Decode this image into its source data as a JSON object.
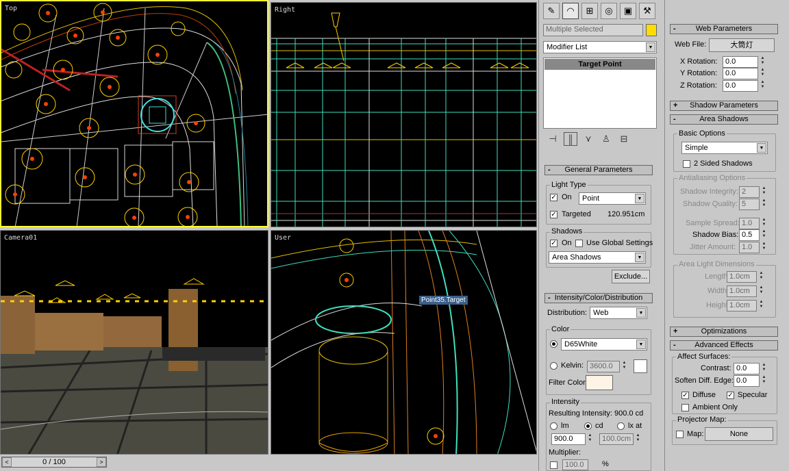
{
  "viewports": {
    "top": "Top",
    "right": "Right",
    "camera": "Camera01",
    "user": "User",
    "tag": "Point35.Target"
  },
  "timeline": {
    "frame": "0 / 100",
    "prev": "<",
    "next": ">"
  },
  "command": {
    "selection": "Multiple Selected",
    "selection_color": "#ffdd00",
    "modifier_list": "Modifier List",
    "stack_item": "Target Point",
    "icons": [
      "create-icon",
      "modify-icon",
      "hierarchy-icon",
      "motion-icon",
      "display-icon",
      "utilities-icon"
    ],
    "stack_tools": [
      "pin-icon",
      "show-end-result-icon",
      "make-unique-icon",
      "remove-modifier-icon",
      "configure-icon"
    ]
  },
  "general": {
    "title": "General Parameters",
    "light_type": "Light Type",
    "on": "On",
    "type_value": "Point",
    "targeted": "Targeted",
    "target_dist": "120.951cm",
    "shadows": "Shadows",
    "shadow_on": "On",
    "use_global": "Use Global Settings",
    "shadow_type": "Area Shadows",
    "exclude": "Exclude..."
  },
  "intensity": {
    "title": "Intensity/Color/Distribution",
    "distribution_label": "Distribution:",
    "distribution": "Web",
    "color": "Color",
    "preset": "D65White",
    "kelvin_label": "Kelvin:",
    "kelvin": "3600.0",
    "filter_label": "Filter Color:",
    "filter_color": "#fdf4e6",
    "kelvin_color": "#ffffff",
    "intensity_group": "Intensity",
    "resulting_label": "Resulting Intensity:",
    "resulting": "900.0 cd",
    "lm": "lm",
    "cd": "cd",
    "lxat": "lx at",
    "value": "900.0",
    "distance": "100.0cm",
    "multiplier_label": "Multiplier:",
    "multiplier": "100.0",
    "percent": "%"
  },
  "web": {
    "title": "Web Parameters",
    "file_label": "Web File:",
    "file": "大筒灯",
    "x_label": "X Rotation:",
    "y_label": "Y Rotation:",
    "z_label": "Z Rotation:",
    "x": "0.0",
    "y": "0.0",
    "z": "0.0"
  },
  "shadow_params": {
    "title": "Shadow Parameters"
  },
  "area_shadows": {
    "title": "Area Shadows",
    "basic": "Basic Options",
    "mode": "Simple",
    "two_sided": "2 Sided Shadows",
    "antialias": "Antialiasing Options",
    "integrity_label": "Shadow Integrity:",
    "integrity": "2",
    "quality_label": "Shadow Quality:",
    "quality": "5",
    "spread_label": "Sample Spread:",
    "spread": "1.0",
    "bias_label": "Shadow Bias:",
    "bias": "0.5",
    "jitter_label": "Jitter Amount:",
    "jitter": "1.0",
    "dims": "Area Light Dimensions",
    "length_label": "Length:",
    "length": "1.0cm",
    "width_label": "Width:",
    "width": "1.0cm",
    "height_label": "Height:",
    "height": "1.0cm"
  },
  "optimizations": {
    "title": "Optimizations"
  },
  "advanced": {
    "title": "Advanced Effects",
    "affect": "Affect Surfaces:",
    "contrast_label": "Contrast:",
    "contrast": "0.0",
    "soften_label": "Soften Diff. Edge:",
    "soften": "0.0",
    "diffuse": "Diffuse",
    "specular": "Specular",
    "ambient": "Ambient Only",
    "projector": "Projector Map:",
    "map_label": "Map:",
    "map": "None"
  }
}
